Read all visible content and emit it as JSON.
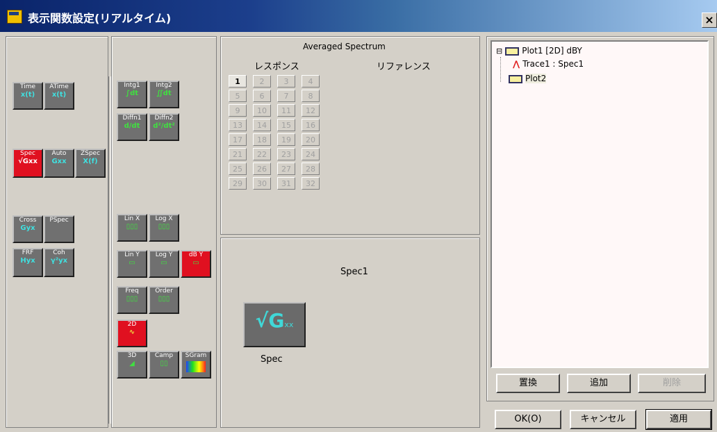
{
  "window": {
    "title": "表示関数設定(リアルタイム)",
    "close_glyph": "×"
  },
  "left_panel": {
    "buttons": [
      {
        "id": "time",
        "label": "Time",
        "glyph": "x(t)"
      },
      {
        "id": "atime",
        "label": "ATime",
        "glyph": "x(t)"
      },
      {
        "id": "spec",
        "label": "Spec",
        "glyph": "√Gxx",
        "active": true
      },
      {
        "id": "auto",
        "label": "Auto",
        "glyph": "Gxx"
      },
      {
        "id": "zspec",
        "label": "ZSpec",
        "glyph": "X(f)"
      },
      {
        "id": "cross",
        "label": "Cross",
        "glyph": "Gyx"
      },
      {
        "id": "pspec",
        "label": "PSpec",
        "glyph": ""
      },
      {
        "id": "frf",
        "label": "FRF",
        "glyph": "Hyx"
      },
      {
        "id": "coh",
        "label": "Coh",
        "glyph": "γ²yx"
      }
    ]
  },
  "mid_panel": {
    "buttons": [
      {
        "id": "intg1",
        "label": "Intg1",
        "glyph": "∫dt"
      },
      {
        "id": "intg2",
        "label": "Intg2",
        "glyph": "∬dt"
      },
      {
        "id": "diffn1",
        "label": "Diffn1",
        "glyph": "d/dt"
      },
      {
        "id": "diffn2",
        "label": "Diffn2",
        "glyph": "d²/dt²"
      },
      {
        "id": "linx",
        "label": "Lin X",
        "glyph": "▯▯▯"
      },
      {
        "id": "logx",
        "label": "Log X",
        "glyph": "▯▯▯"
      },
      {
        "id": "liny",
        "label": "Lin Y",
        "glyph": "▭"
      },
      {
        "id": "logy",
        "label": "Log Y",
        "glyph": "▭"
      },
      {
        "id": "dby",
        "label": "dB Y",
        "glyph": "▭",
        "active": true
      },
      {
        "id": "freq",
        "label": "Freq",
        "glyph": "▯▯▯"
      },
      {
        "id": "order",
        "label": "Order",
        "glyph": "▯▯▯"
      },
      {
        "id": "2d",
        "label": "2D",
        "glyph": "∿",
        "active": true
      },
      {
        "id": "3d",
        "label": "3D",
        "glyph": "◢"
      },
      {
        "id": "camp",
        "label": "Camp",
        "glyph": "▯▯"
      },
      {
        "id": "sgram",
        "label": "SGram",
        "glyph": "█"
      }
    ]
  },
  "spectrum": {
    "heading": "Averaged Spectrum",
    "response_label": "レスポンス",
    "reference_label": "リファレンス",
    "cells": [
      "1",
      "2",
      "3",
      "4",
      "5",
      "6",
      "7",
      "8",
      "9",
      "10",
      "11",
      "12",
      "13",
      "14",
      "15",
      "16",
      "17",
      "18",
      "19",
      "20",
      "21",
      "22",
      "23",
      "24",
      "25",
      "26",
      "27",
      "28",
      "29",
      "30",
      "31",
      "32"
    ],
    "selected": "1"
  },
  "preview": {
    "title": "Spec1",
    "icon_glyph": "√G",
    "icon_sub": "xx",
    "caption": "Spec"
  },
  "tree": {
    "plot1": "Plot1 [2D] dBY",
    "trace1": "Trace1 : Spec1",
    "plot2": "Plot2",
    "expander": "⊟"
  },
  "tree_buttons": {
    "replace": "置換",
    "add": "追加",
    "delete": "削除"
  },
  "dialog_buttons": {
    "ok": "OK(O)",
    "cancel": "キャンセル",
    "apply": "適用"
  }
}
